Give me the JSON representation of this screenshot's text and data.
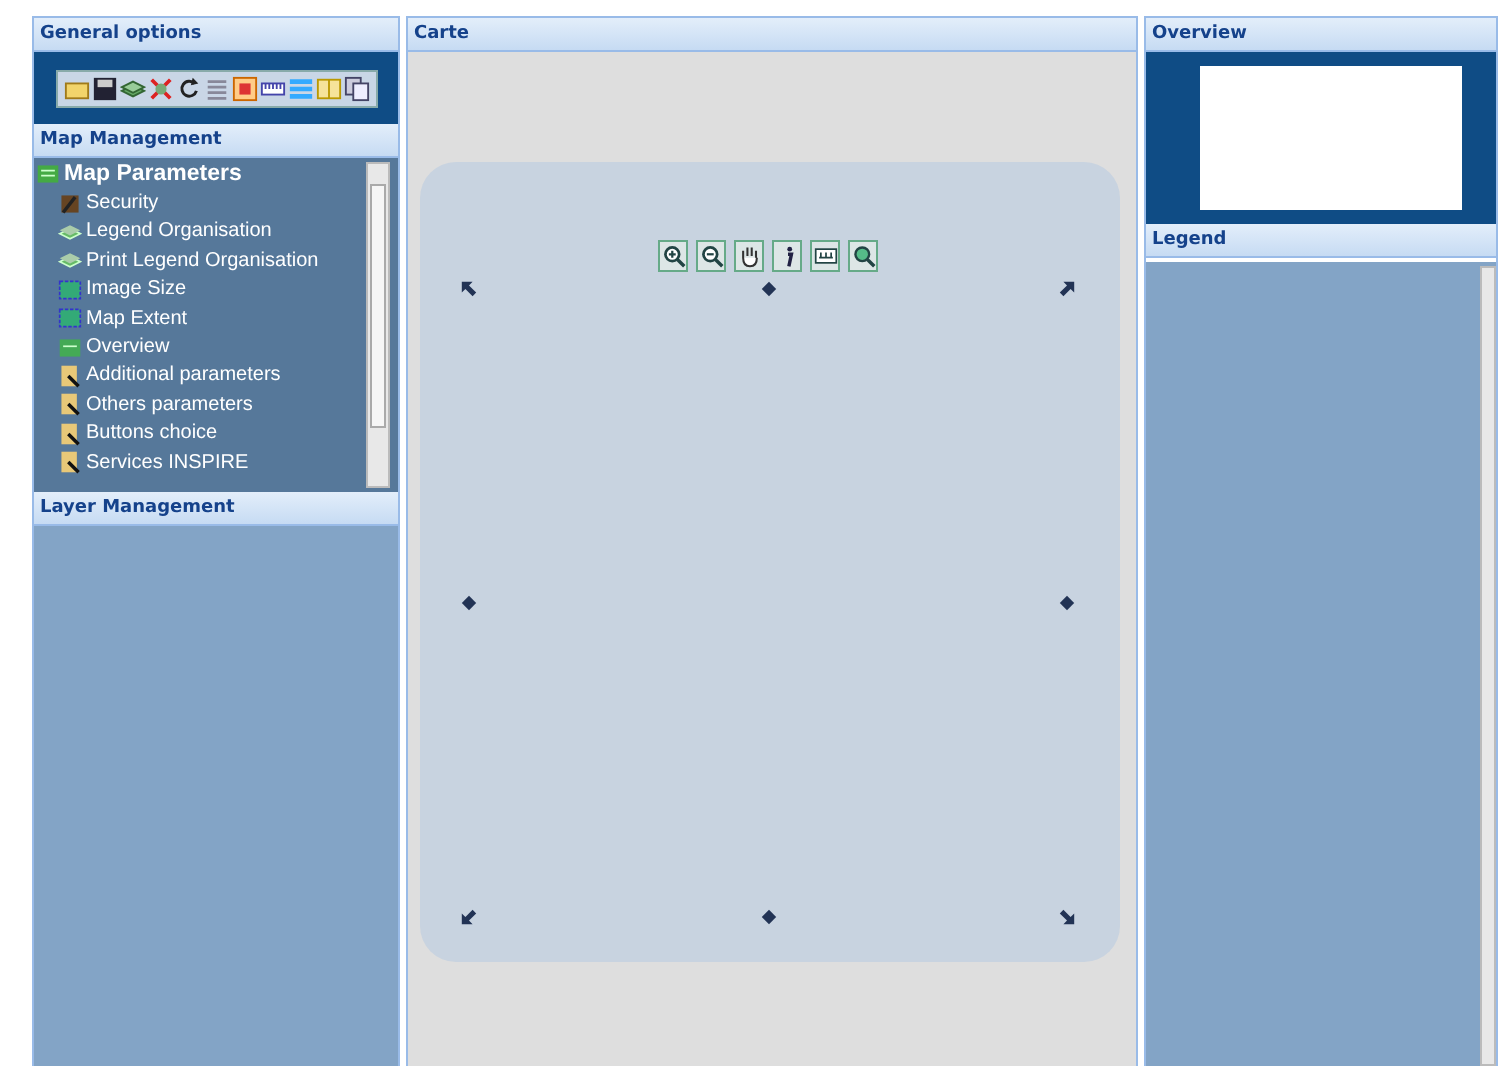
{
  "general_options": {
    "title": "General options"
  },
  "map_management": {
    "title": "Map Management",
    "tree": [
      {
        "label": "Map Parameters",
        "kind": "root",
        "children": [
          {
            "label": "Security",
            "kind": "security"
          },
          {
            "label": "Legend Organisation",
            "kind": "legend"
          },
          {
            "label": "Print Legend Organisation",
            "kind": "legend"
          },
          {
            "label": "Image Size",
            "kind": "image"
          },
          {
            "label": "Map Extent",
            "kind": "image"
          },
          {
            "label": "Overview",
            "kind": "overview"
          },
          {
            "label": "Additional parameters",
            "kind": "params"
          },
          {
            "label": "Others parameters",
            "kind": "params"
          },
          {
            "label": "Buttons choice",
            "kind": "params"
          },
          {
            "label": "Services INSPIRE",
            "kind": "params"
          }
        ]
      }
    ]
  },
  "layer_management": {
    "title": "Layer Management"
  },
  "map": {
    "title": "Carte"
  },
  "overview": {
    "title": "Overview"
  },
  "legend": {
    "title": "Legend"
  }
}
